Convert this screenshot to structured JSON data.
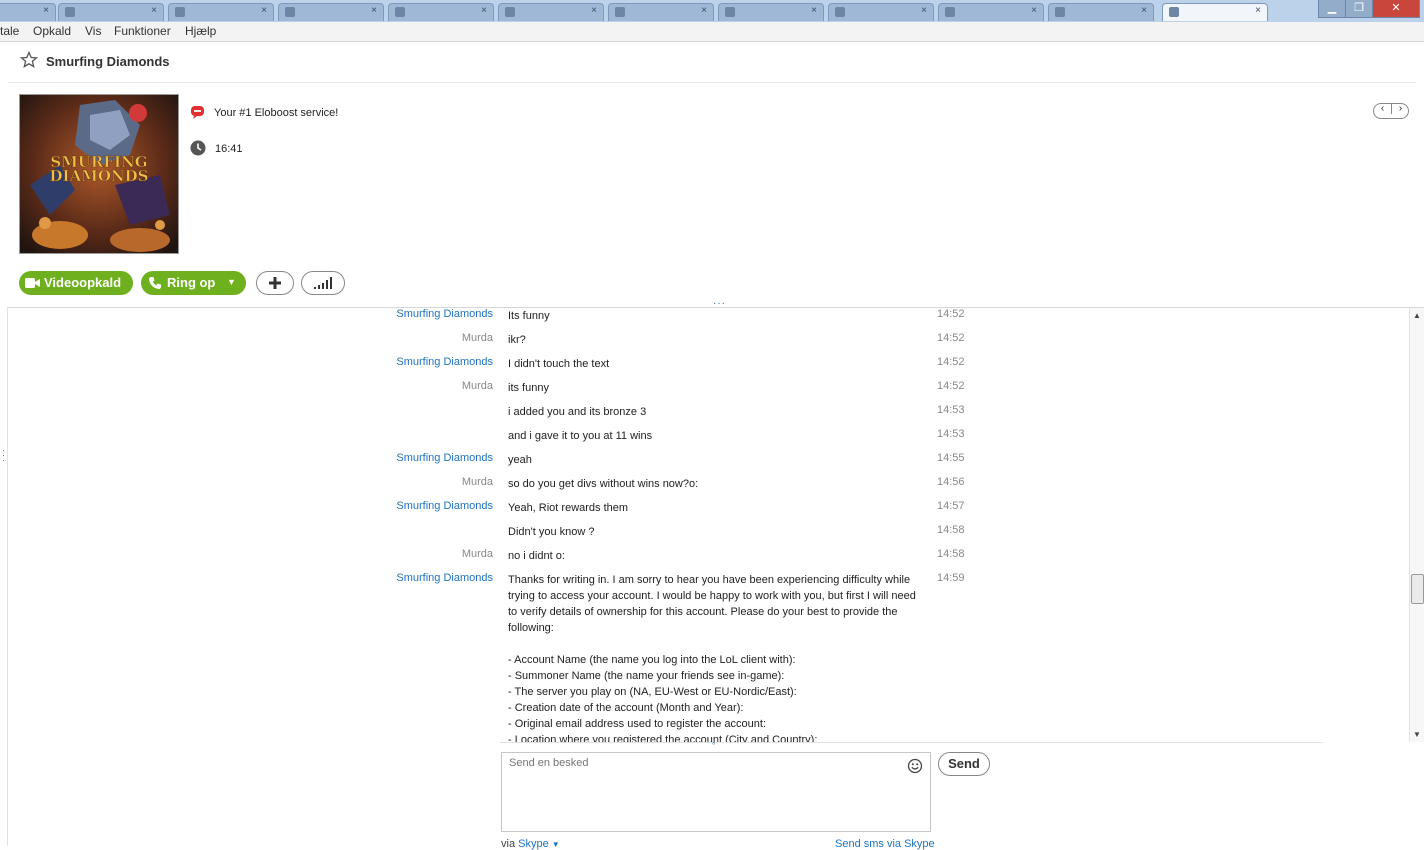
{
  "menubar": {
    "items": [
      "tale",
      "Opkald",
      "Vis",
      "Funktioner",
      "Hjælp"
    ]
  },
  "header": {
    "title": "Smurfing Diamonds",
    "mood": "Your #1 Eloboost service!",
    "local_time": "16:41",
    "avatar_text_line1": "SMURFING",
    "avatar_text_line2": "DIAMONDS"
  },
  "actions": {
    "video_label": "Videoopkald",
    "call_label": "Ring op"
  },
  "messages": [
    {
      "sender": "Smurfing Diamonds",
      "type": "sd",
      "text": "Its funny",
      "time": "14:52"
    },
    {
      "sender": "Murda",
      "type": "mu",
      "text": "ikr?",
      "time": "14:52"
    },
    {
      "sender": "Smurfing Diamonds",
      "type": "sd",
      "text": "I didn't touch the text",
      "time": "14:52"
    },
    {
      "sender": "Murda",
      "type": "mu",
      "text": "its funny",
      "time": "14:52"
    },
    {
      "sender": "",
      "type": "mu",
      "text": "i added you and its bronze 3",
      "time": "14:53"
    },
    {
      "sender": "",
      "type": "mu",
      "text": "and i gave it to you at 11 wins",
      "time": "14:53"
    },
    {
      "sender": "Smurfing Diamonds",
      "type": "sd",
      "text": "yeah",
      "time": "14:55"
    },
    {
      "sender": "Murda",
      "type": "mu",
      "text": "so do you get divs without wins now?o:",
      "time": "14:56"
    },
    {
      "sender": "Smurfing Diamonds",
      "type": "sd",
      "text": "Yeah, Riot rewards them",
      "time": "14:57"
    },
    {
      "sender": "",
      "type": "sd",
      "text": "Didn't you know ?",
      "time": "14:58"
    },
    {
      "sender": "Murda",
      "type": "mu",
      "text": "no i didnt o:",
      "time": "14:58"
    },
    {
      "sender": "Smurfing Diamonds",
      "type": "sd",
      "text": "Thanks for writing in. I am sorry to hear you have been experiencing difficulty while trying to access your account. I would be happy to work with you, but first I will need to verify details of ownership for this account. Please do your best to provide the following:\n\n- Account Name (the name you log into the LoL client with):\n- Summoner Name (the name your friends see in-game):\n- The server you play on (NA, EU-West or EU-Nordic/East):\n- Creation date of the account (Month and Year):\n- Original email address used to register the account:\n- Location where you registered the account (City and Country):",
      "time": "14:59"
    }
  ],
  "composer": {
    "placeholder": "Send en besked",
    "send_label": "Send",
    "via_label": "via",
    "via_service": "Skype",
    "sms_label": "Send sms via Skype"
  }
}
